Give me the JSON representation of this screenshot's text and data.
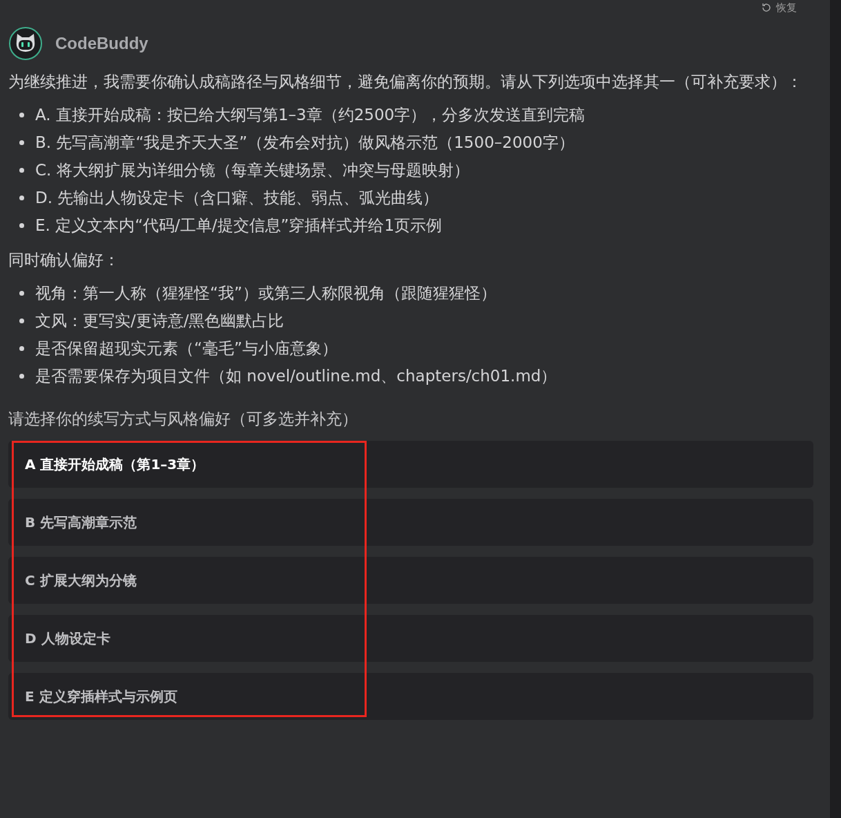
{
  "restore_button": {
    "label": "恢复"
  },
  "assistant": {
    "name": "CodeBuddy"
  },
  "message": {
    "intro": "为继续推进，我需要你确认成稿路径与风格细节，避免偏离你的预期。请从下列选项中选择其一（可补充要求）：",
    "options_list": [
      "A. 直接开始成稿：按已给大纲写第1–3章（约2500字），分多次发送直到完稿",
      "B. 先写高潮章“我是齐天大圣”（发布会对抗）做风格示范（1500–2000字）",
      "C. 将大纲扩展为详细分镜（每章关键场景、冲突与母题映射）",
      "D. 先输出人物设定卡（含口癖、技能、弱点、弧光曲线）",
      "E. 定义文本内“代码/工单/提交信息”穿插样式并给1页示例"
    ],
    "preferences_heading": "同时确认偏好：",
    "preferences_list": [
      "视角：第一人称（猩猩怪“我”）或第三人称限视角（跟随猩猩怪）",
      "文风：更写实/更诗意/黑色幽默占比",
      "是否保留超现实元素（“毫毛”与小庙意象）",
      "是否需要保存为项目文件（如 novel/outline.md、chapters/ch01.md）"
    ]
  },
  "question": {
    "prompt": "请选择你的续写方式与风格偏好（可多选并补充）",
    "choices": [
      {
        "label": "A 直接开始成稿（第1–3章）",
        "selected": true
      },
      {
        "label": "B 先写高潮章示范",
        "selected": false
      },
      {
        "label": "C 扩展大纲为分镜",
        "selected": false
      },
      {
        "label": "D 人物设定卡",
        "selected": false
      },
      {
        "label": "E 定义穿插样式与示例页",
        "selected": false
      }
    ]
  }
}
